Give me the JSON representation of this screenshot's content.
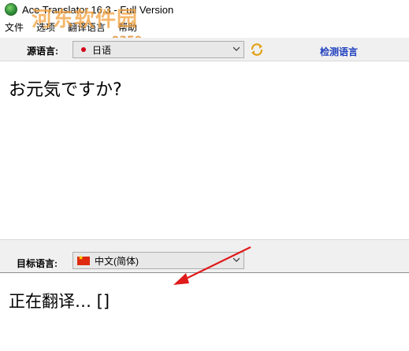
{
  "window": {
    "title": "Ace Translator 16.3 - Full Version",
    "icon": "globe-icon"
  },
  "watermark": {
    "text": "河东软件园",
    "url": "www.pc0359.cn"
  },
  "menu": {
    "items": [
      "文件",
      "选项",
      "翻译语言",
      "帮助"
    ]
  },
  "source": {
    "label": "源语言:",
    "language": "日语",
    "flag_icon": "japan-flag-icon",
    "swap_icon": "swap-refresh-icon",
    "detect_label": "检测语言",
    "text": "お元気ですか?"
  },
  "target": {
    "label": "目标语言:",
    "language": "中文(简体)",
    "flag_icon": "china-flag-icon",
    "text": "正在翻译… []"
  },
  "colors": {
    "link": "#1f3fbf",
    "arrow": "#e01b1b",
    "watermark": "#f2a03a"
  }
}
